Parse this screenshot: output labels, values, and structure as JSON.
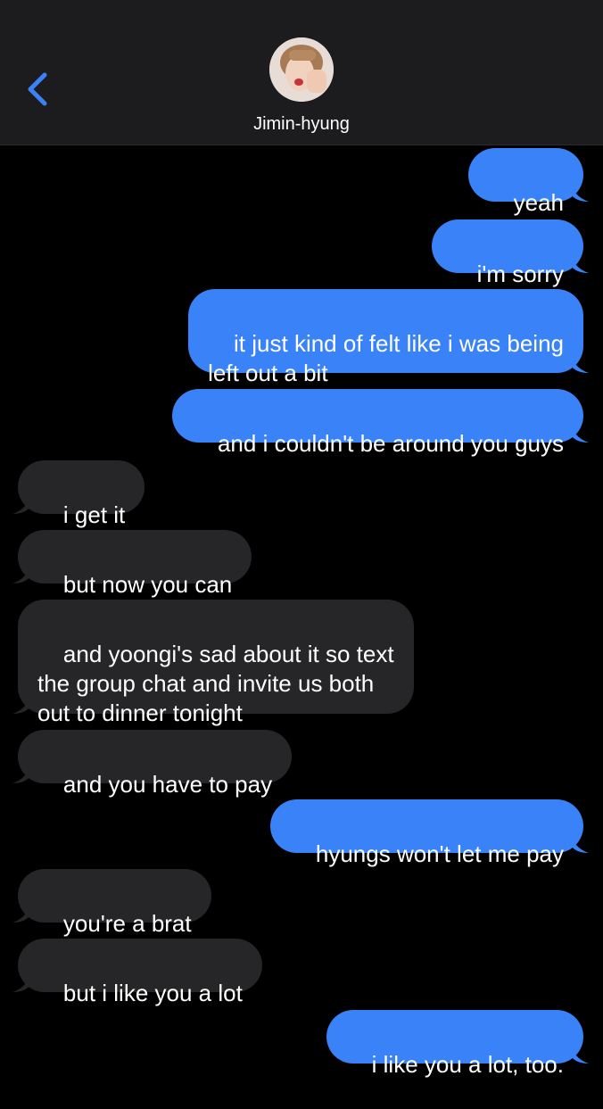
{
  "header": {
    "contact_name": "Jimin-hyung",
    "back_icon": "chevron-left-icon",
    "avatar": "contact-avatar-photo"
  },
  "colors": {
    "sent_bubble": "#3a82f7",
    "received_bubble": "#262628",
    "background": "#000000",
    "header_bg": "#1c1c1e",
    "accent": "#3a82f7"
  },
  "messages": [
    {
      "from": "me",
      "text": "yeah"
    },
    {
      "from": "me",
      "text": "i'm sorry"
    },
    {
      "from": "me",
      "text": "it just kind of felt like i was being\nleft out a bit"
    },
    {
      "from": "me",
      "text": "and i couldn't be around you guys"
    },
    {
      "from": "them",
      "text": "i get it"
    },
    {
      "from": "them",
      "text": "but now you can"
    },
    {
      "from": "them",
      "text": "and yoongi's sad about it so text\nthe group chat and invite us both\nout to dinner tonight"
    },
    {
      "from": "them",
      "text": "and you have to pay"
    },
    {
      "from": "me",
      "text": "hyungs won't let me pay"
    },
    {
      "from": "them",
      "text": "you're a brat"
    },
    {
      "from": "them",
      "text": "but i like you a lot"
    },
    {
      "from": "me",
      "text": "i like you a lot, too."
    }
  ]
}
